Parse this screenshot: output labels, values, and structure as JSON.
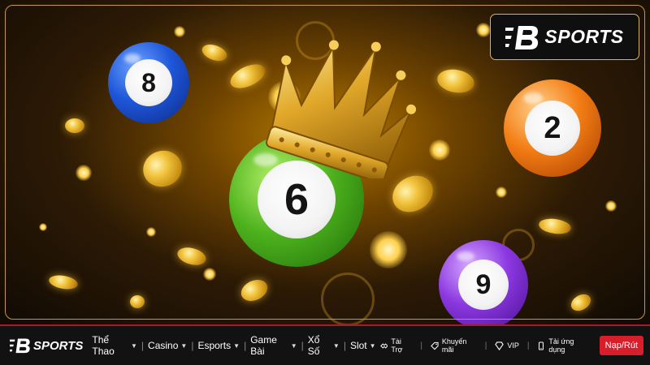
{
  "brand": {
    "name": "SPORTS",
    "accent": "#d9b25a"
  },
  "banner": {
    "balls": [
      {
        "number": "8",
        "color": "#1e56d9"
      },
      {
        "number": "6",
        "color": "#4db21d"
      },
      {
        "number": "2",
        "color": "#f37d14"
      },
      {
        "number": "9",
        "color": "#8b38e0"
      }
    ],
    "crown_icon": "crown-icon"
  },
  "nav": {
    "menu": [
      {
        "label": "Thể Thao"
      },
      {
        "label": "Casino"
      },
      {
        "label": "Esports"
      },
      {
        "label": "Game Bài"
      },
      {
        "label": "Xổ Số"
      },
      {
        "label": "Slot"
      }
    ],
    "links": [
      {
        "label": "Tài Trợ",
        "icon": "handshake-icon"
      },
      {
        "label": "Khuyến mãi",
        "icon": "tag-icon"
      },
      {
        "label": "VIP",
        "icon": "diamond-icon"
      },
      {
        "label": "Tải ứng dụng",
        "icon": "phone-icon"
      }
    ],
    "cta_label": "Nạp/Rút",
    "cta_color": "#d71f2b",
    "border_color": "#a9182b"
  }
}
